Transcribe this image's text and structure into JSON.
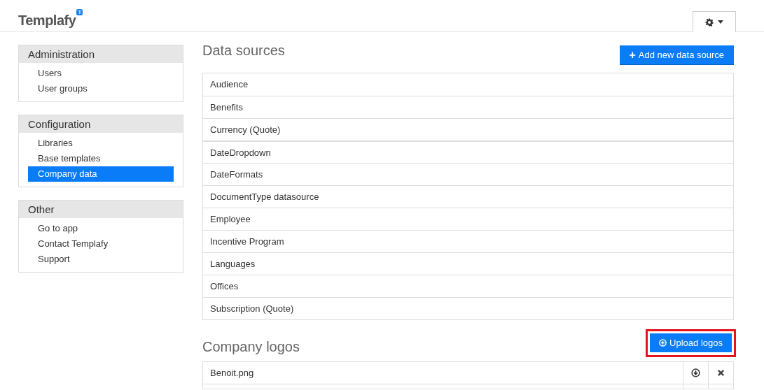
{
  "header": {
    "logo": "Templafy",
    "logo_badge": "T"
  },
  "sidebar": [
    {
      "title": "Administration",
      "items": [
        {
          "label": "Users",
          "selected": false
        },
        {
          "label": "User groups",
          "selected": false
        }
      ]
    },
    {
      "title": "Configuration",
      "items": [
        {
          "label": "Libraries",
          "selected": false
        },
        {
          "label": "Base templates",
          "selected": false
        },
        {
          "label": "Company data",
          "selected": true
        }
      ]
    },
    {
      "title": "Other",
      "items": [
        {
          "label": "Go to app",
          "selected": false
        },
        {
          "label": "Contact Templafy",
          "selected": false
        },
        {
          "label": "Support",
          "selected": false
        }
      ]
    }
  ],
  "data_sources": {
    "title": "Data sources",
    "button": "Add new data source",
    "button_icon": "+",
    "items": [
      "Audience",
      "Benefits",
      "Currency (Quote)",
      "DateDropdown",
      "DateFormats",
      "DocumentType datasource",
      "Employee",
      "Incentive Program",
      "Languages",
      "Offices",
      "Subscription (Quote)"
    ]
  },
  "company_logos": {
    "title": "Company logos",
    "button": "Upload logos",
    "highlighted": true,
    "items": [
      "Benoit.png"
    ]
  }
}
